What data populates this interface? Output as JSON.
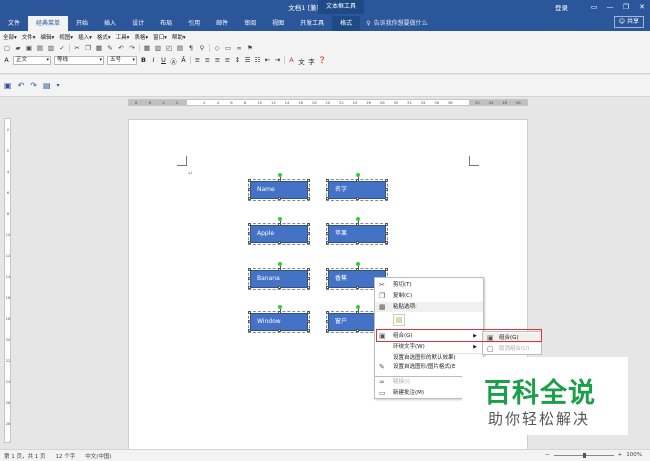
{
  "window": {
    "title": "文档1 [兼容模式] - Word",
    "context_tools": "文本框工具",
    "login": "登录",
    "controls": [
      "—",
      "❐",
      "✕"
    ]
  },
  "tabs": [
    "文件",
    "经典菜单",
    "开始",
    "插入",
    "设计",
    "布局",
    "引用",
    "邮件",
    "审阅",
    "视图",
    "开发工具",
    "格式"
  ],
  "active_tab": "经典菜单",
  "tell_me": "告诉我你想要做什么",
  "share": "共享",
  "menu_row": [
    "全部▾",
    "文件▾",
    "编辑▾",
    "视图▾",
    "插入▾",
    "格式▾",
    "工具▾",
    "表格▾",
    "窗口▾",
    "帮助▾"
  ],
  "format_row": {
    "style": "正文",
    "font": "等线",
    "size": "五号"
  },
  "ruler_ticks": [
    "8",
    "6",
    "4",
    "2",
    "",
    "2",
    "4",
    "6",
    "8",
    "10",
    "12",
    "14",
    "16",
    "18",
    "20",
    "22",
    "24",
    "26",
    "28",
    "30",
    "32",
    "34",
    "36",
    "38",
    "",
    "42",
    "44",
    "46",
    "48"
  ],
  "vruler_ticks": [
    "2",
    "2",
    "4",
    "6",
    "8",
    "10",
    "12",
    "14",
    "16",
    "18",
    "20",
    "22",
    "24",
    "26",
    "28"
  ],
  "shapes": [
    {
      "label": "Name"
    },
    {
      "label": "名字"
    },
    {
      "label": "Apple"
    },
    {
      "label": "苹果"
    },
    {
      "label": "Banana"
    },
    {
      "label": "香蕉"
    },
    {
      "label": "Window"
    },
    {
      "label": "窗户"
    }
  ],
  "context_menu": {
    "cut": "剪切(T)",
    "copy": "复制(C)",
    "paste_options": "粘贴选项:",
    "group": "组合(G)",
    "wrap_text": "环绕文字(W)",
    "set_default": "设置自选图形的默认效果(",
    "format_shape": "设置自选图形/图片格式(E",
    "link": "链接(I)",
    "new_comment": "新建批注(M)"
  },
  "submenu": {
    "group": "组合(G)",
    "ungroup": "取消组合(U)"
  },
  "watermark": {
    "big": "百科全说",
    "small": "助你轻松解决"
  },
  "status": {
    "page": "第 1 页，共 1 页",
    "words": "12 个字",
    "lang": "中文(中国)",
    "zoom": "100%"
  },
  "colors": {
    "brand": "#2b579a",
    "shape_fill": "#4472c4",
    "highlight_border": "#d9343c",
    "watermark_green": "#1aa04a"
  }
}
